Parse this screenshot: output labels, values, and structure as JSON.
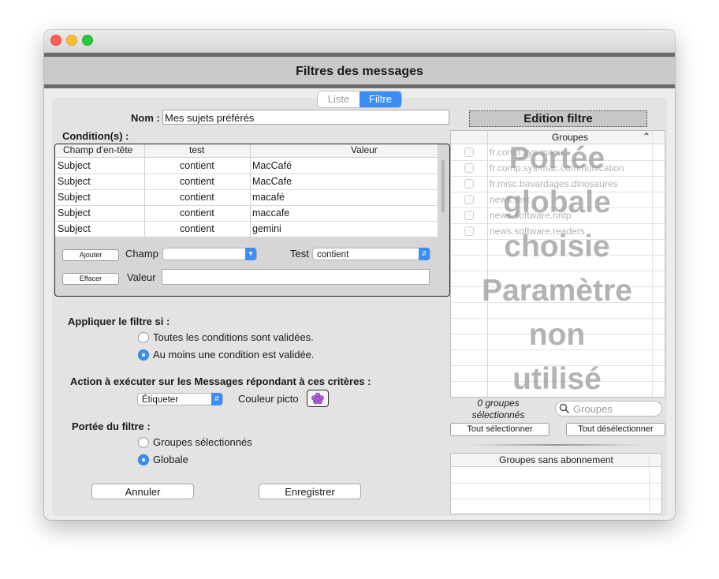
{
  "window": {
    "title": "Filtres des messages"
  },
  "tabs": [
    {
      "label": "Liste",
      "active": false
    },
    {
      "label": "Filtre",
      "active": true
    }
  ],
  "name_field": {
    "label": "Nom :",
    "value": "Mes sujets préférés"
  },
  "conditions": {
    "label": "Condition(s) :",
    "columns": [
      "Champ d'en-tête",
      "test",
      "Valeur"
    ],
    "rows": [
      [
        "Subject",
        "contient",
        "MacCafé"
      ],
      [
        "Subject",
        "contient",
        "MacCafe"
      ],
      [
        "Subject",
        "contient",
        "macafé"
      ],
      [
        "Subject",
        "contient",
        "maccafe"
      ],
      [
        "Subject",
        "contient",
        "gemini"
      ]
    ],
    "add_button": "Ajouter",
    "delete_button": "Effacer",
    "champ_label": "Champ",
    "champ_value": "",
    "test_label": "Test",
    "test_value": "contient",
    "valeur_label": "Valeur",
    "valeur_value": ""
  },
  "apply": {
    "label": "Appliquer le filtre si :",
    "options": [
      {
        "label": "Toutes les conditions sont validées.",
        "selected": false
      },
      {
        "label": "Au moins une condition est validée.",
        "selected": true
      }
    ]
  },
  "action": {
    "label": "Action à exécuter sur les Messages répondant à ces critères :",
    "select_value": "Étiqueter",
    "color_label": "Couleur picto",
    "color": "#b05ed8"
  },
  "scope": {
    "label": "Portée du filtre :",
    "options": [
      {
        "label": "Groupes sélectionnés",
        "selected": false
      },
      {
        "label": "Globale",
        "selected": true
      }
    ]
  },
  "buttons": {
    "cancel": "Annuler",
    "save": "Enregistrer"
  },
  "edition": {
    "title": "Edition filtre"
  },
  "groups": {
    "header": "Groupes",
    "items": [
      "fr.comp.sys.mac.x",
      "fr.comp.sys.mac.communication",
      "fr.misc.bavardages.dinosaures",
      "news.test",
      "news.software.nntp",
      "news.software.readers"
    ],
    "overlay_lines": [
      "Portée",
      "globale",
      "choisie",
      "Paramètre",
      "non",
      "utilisé"
    ],
    "count_line1": "0 groupes",
    "count_line2": "sélectionnés",
    "search_placeholder": "Groupes",
    "select_all": "Tout sélectionner",
    "deselect_all": "Tout désélectionner"
  },
  "no_subscription": {
    "header": "Groupes sans abonnement"
  },
  "colors": {
    "accent": "#3b8ef5",
    "header_bar": "#6b6b6b",
    "header_band": "#c9c9c9"
  }
}
